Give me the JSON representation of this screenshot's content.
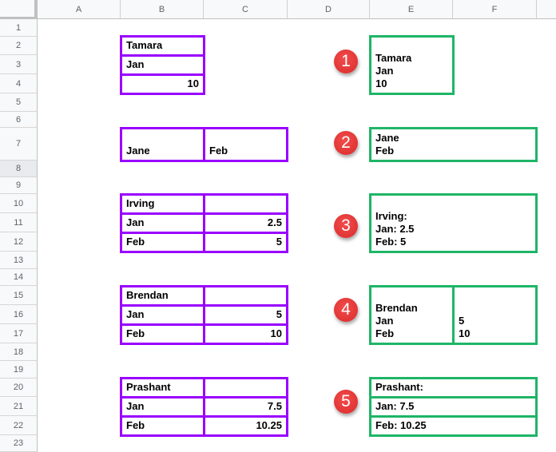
{
  "sheet": {
    "columns": [
      "A",
      "B",
      "C",
      "D",
      "E",
      "F"
    ],
    "rows": [
      "1",
      "2",
      "3",
      "4",
      "5",
      "6",
      "7",
      "8",
      "9",
      "10",
      "11",
      "12",
      "13",
      "14",
      "15",
      "16",
      "17",
      "18",
      "19",
      "20",
      "21",
      "22",
      "23"
    ],
    "selected_row": "8"
  },
  "colors": {
    "source_border": "#9900ff",
    "result_border": "#1eb567",
    "badge": "#e53935"
  },
  "examples": [
    {
      "badge": "1",
      "source": {
        "B2": "Tamara",
        "B3": "Jan",
        "B4": "10"
      },
      "result": {
        "E2:F4": [
          "Tamara",
          "Jan",
          "10"
        ]
      }
    },
    {
      "badge": "2",
      "source": {
        "B7": "Jane",
        "C7": "Feb"
      },
      "result": {
        "E7:F7": [
          "Jane",
          "Feb"
        ]
      }
    },
    {
      "badge": "3",
      "source": {
        "B10": "Irving",
        "C10": "",
        "B11": "Jan",
        "C11": "2.5",
        "B12": "Feb",
        "C12": "5"
      },
      "result": {
        "E10:F12": [
          "Irving:",
          "Jan: 2.5",
          "Feb: 5"
        ]
      }
    },
    {
      "badge": "4",
      "source": {
        "B15": "Brendan",
        "C15": "",
        "B16": "Jan",
        "C16": "5",
        "B17": "Feb",
        "C17": "10"
      },
      "result": {
        "E15:E17": [
          "Brendan",
          "Jan",
          "Feb"
        ],
        "F15:F17": [
          "5",
          "10"
        ]
      }
    },
    {
      "badge": "5",
      "source": {
        "B20": "Prashant",
        "C20": "",
        "B21": "Jan",
        "C21": "7.5",
        "B22": "Feb",
        "C22": "10.25"
      },
      "result": {
        "E20:F20": "Prashant:",
        "E21:F21": "Jan: 7.5",
        "E22:F22": "Feb: 10.25"
      }
    }
  ]
}
